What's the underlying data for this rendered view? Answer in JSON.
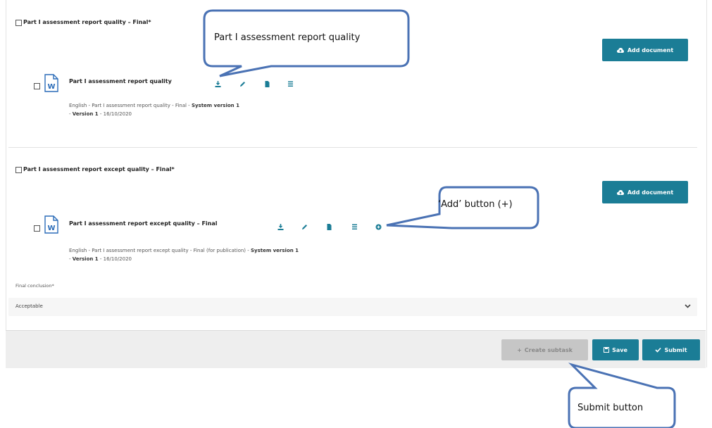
{
  "sections": [
    {
      "title": "Part I assessment report quality – Final*",
      "add_button": "Add document",
      "document": {
        "title": "Part I assessment report quality",
        "meta_line1_prefix": "English - Part I assessment report quality - Final - ",
        "meta_line1_bold": "System version 1",
        "meta_line2_bold": "Version 1",
        "meta_line2_suffix": " - 16/10/2020"
      }
    },
    {
      "title": "Part I assessment report except quality – Final*",
      "add_button": "Add document",
      "document": {
        "title": "Part I assessment report except quality – Final",
        "meta_line1_prefix": "English - Part I assessment report except quality - Final (for publication) - ",
        "meta_line1_bold": "System version 1",
        "meta_line2_bold": "Version 1",
        "meta_line2_suffix": " - 16/10/2020"
      }
    }
  ],
  "final_conclusion": {
    "label": "Final conclusion*",
    "value": "Acceptable"
  },
  "footer": {
    "create_subtask": "Create subtask",
    "save": "Save",
    "submit": "Submit"
  },
  "callouts": {
    "top": "Part I assessment report quality",
    "add": "‘Add’ button (+)",
    "submit": "Submit button"
  },
  "colors": {
    "accent": "#1b7d96",
    "callout_border": "#4a72b4",
    "icon": "#1b7d96",
    "word_blue": "#2b6cb8"
  }
}
